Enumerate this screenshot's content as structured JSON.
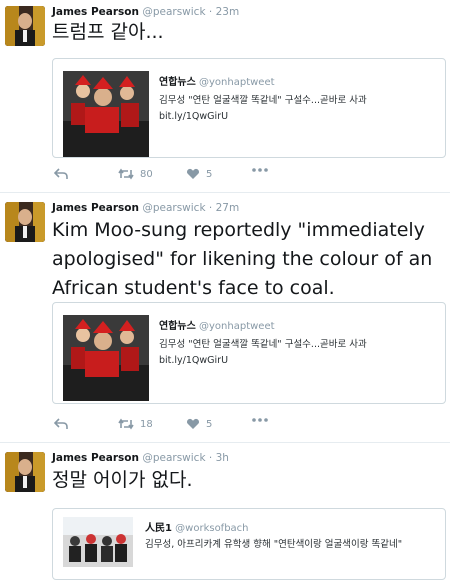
{
  "tweets": [
    {
      "name": "James Pearson",
      "handle": "@pearswick",
      "time": "23m",
      "text": "트럼프 같아...",
      "card": {
        "name": "연합뉴스",
        "handle": "@yonhaptweet",
        "text": "김무성 \"연탄 얼굴색깔 똑같네\" 구설수...곧바로 사과",
        "link": "bit.ly/1QwGirU"
      },
      "retweets": "80",
      "likes": "5"
    },
    {
      "name": "James Pearson",
      "handle": "@pearswick",
      "time": "27m",
      "text": "Kim Moo-sung reportedly \"immediately apologised\" for likening the colour of an African student's face to coal.",
      "card": {
        "name": "연합뉴스",
        "handle": "@yonhaptweet",
        "text": "김무성 \"연탄 얼굴색깔 똑같네\" 구설수...곧바로 사과",
        "link": "bit.ly/1QwGirU"
      },
      "retweets": "18",
      "likes": "5"
    },
    {
      "name": "James Pearson",
      "handle": "@pearswick",
      "time": "3h",
      "text": "정말 어이가 없다.",
      "card": {
        "name": "人民1",
        "handle": "@worksofbach",
        "text": "김무성, 아프리카계 유학생 향해 \"연탄색이랑 얼굴색이랑 똑같네\""
      }
    }
  ],
  "colors": {
    "name": "#14171a",
    "meta": "#8899a6",
    "border": "#cfd9de",
    "separator": "#e6ecf0"
  },
  "icons": [
    "reply-icon",
    "retweet-icon",
    "like-icon",
    "more-icon"
  ]
}
